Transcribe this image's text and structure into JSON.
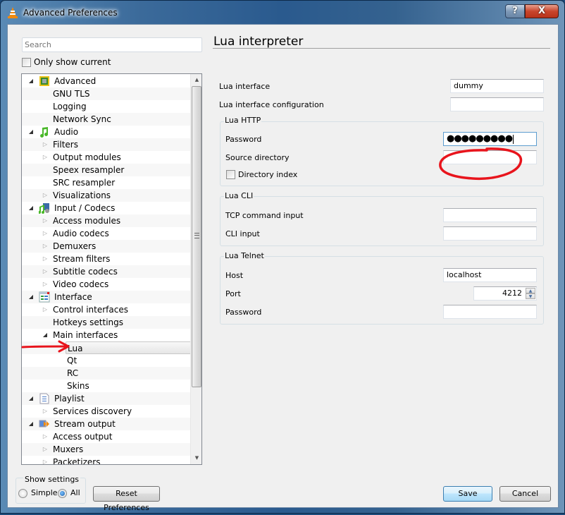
{
  "window": {
    "title": "Advanced Preferences",
    "help_label": "?",
    "close_label": "X"
  },
  "sidebar": {
    "search_placeholder": "Search",
    "only_show_current_label": "Only show current",
    "only_show_current_checked": false,
    "tree": [
      {
        "label": "Advanced",
        "level": 0,
        "expander": "open",
        "icon": "cpu-chip-icon"
      },
      {
        "label": "GNU TLS",
        "level": 1,
        "expander": "none"
      },
      {
        "label": "Logging",
        "level": 1,
        "expander": "none"
      },
      {
        "label": "Network Sync",
        "level": 1,
        "expander": "none"
      },
      {
        "label": "Audio",
        "level": 0,
        "expander": "open",
        "icon": "music-note-icon"
      },
      {
        "label": "Filters",
        "level": 1,
        "expander": "closed"
      },
      {
        "label": "Output modules",
        "level": 1,
        "expander": "closed"
      },
      {
        "label": "Speex resampler",
        "level": 1,
        "expander": "none"
      },
      {
        "label": "SRC resampler",
        "level": 1,
        "expander": "none"
      },
      {
        "label": "Visualizations",
        "level": 1,
        "expander": "closed"
      },
      {
        "label": "Input / Codecs",
        "level": 0,
        "expander": "open",
        "icon": "codecs-icon"
      },
      {
        "label": "Access modules",
        "level": 1,
        "expander": "closed"
      },
      {
        "label": "Audio codecs",
        "level": 1,
        "expander": "closed"
      },
      {
        "label": "Demuxers",
        "level": 1,
        "expander": "closed"
      },
      {
        "label": "Stream filters",
        "level": 1,
        "expander": "closed"
      },
      {
        "label": "Subtitle codecs",
        "level": 1,
        "expander": "closed"
      },
      {
        "label": "Video codecs",
        "level": 1,
        "expander": "closed"
      },
      {
        "label": "Interface",
        "level": 0,
        "expander": "open",
        "icon": "interface-window-icon"
      },
      {
        "label": "Control interfaces",
        "level": 1,
        "expander": "closed"
      },
      {
        "label": "Hotkeys settings",
        "level": 1,
        "expander": "none"
      },
      {
        "label": "Main interfaces",
        "level": 1,
        "expander": "open"
      },
      {
        "label": "Lua",
        "level": 2,
        "expander": "none",
        "selected": true
      },
      {
        "label": "Qt",
        "level": 2,
        "expander": "none"
      },
      {
        "label": "RC",
        "level": 2,
        "expander": "none"
      },
      {
        "label": "Skins",
        "level": 2,
        "expander": "none"
      },
      {
        "label": "Playlist",
        "level": 0,
        "expander": "open",
        "icon": "playlist-icon"
      },
      {
        "label": "Services discovery",
        "level": 1,
        "expander": "closed"
      },
      {
        "label": "Stream output",
        "level": 0,
        "expander": "open",
        "icon": "stream-output-icon"
      },
      {
        "label": "Access output",
        "level": 1,
        "expander": "closed"
      },
      {
        "label": "Muxers",
        "level": 1,
        "expander": "closed"
      },
      {
        "label": "Packetizers",
        "level": 1,
        "expander": "closed"
      }
    ]
  },
  "show_settings": {
    "legend": "Show settings",
    "simple_label": "Simple",
    "all_label": "All",
    "selected": "All"
  },
  "footer": {
    "reset_label": "Reset Preferences",
    "save_label": "Save",
    "cancel_label": "Cancel"
  },
  "panel": {
    "title": "Lua interpreter",
    "lua_interface_label": "Lua interface",
    "lua_interface_value": "dummy",
    "lua_interface_config_label": "Lua interface configuration",
    "lua_interface_config_value": "",
    "http": {
      "legend": "Lua HTTP",
      "password_label": "Password",
      "password_value": "●●●●●●●●●",
      "source_dir_label": "Source directory",
      "source_dir_value": "",
      "dir_index_label": "Directory index",
      "dir_index_checked": false
    },
    "cli": {
      "legend": "Lua CLI",
      "tcp_label": "TCP command input",
      "tcp_value": "",
      "cli_input_label": "CLI input",
      "cli_input_value": ""
    },
    "telnet": {
      "legend": "Lua Telnet",
      "host_label": "Host",
      "host_value": "localhost",
      "port_label": "Port",
      "port_value": "4212",
      "password_label": "Password",
      "password_value": ""
    }
  },
  "annotations": {
    "color": "#e8141c"
  }
}
